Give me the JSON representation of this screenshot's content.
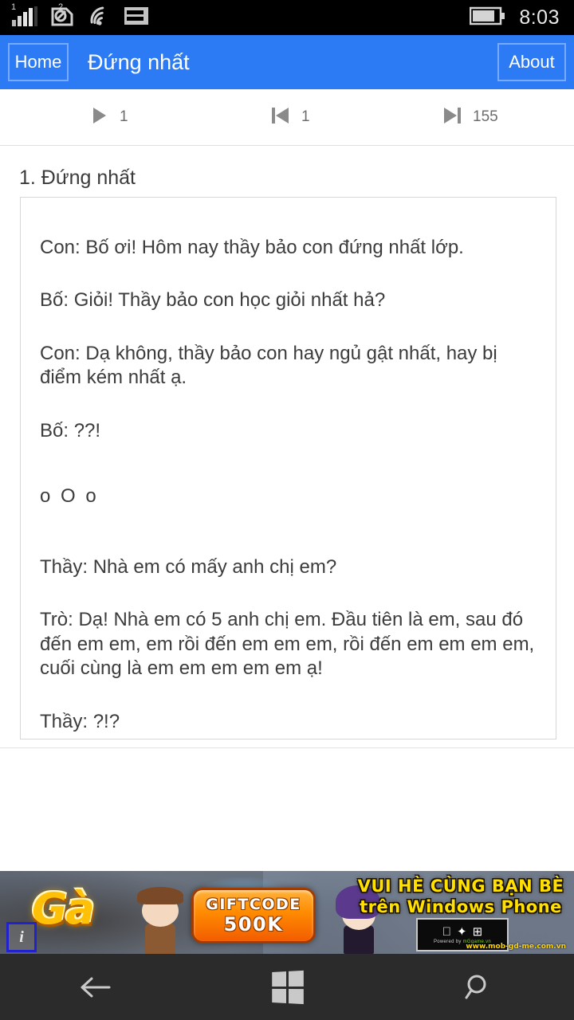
{
  "status_bar": {
    "signal_label": "1",
    "data_label": "2",
    "time": "8:03",
    "icons": [
      "signal-bars-icon",
      "data-connection-icon",
      "wifi-icon",
      "sim-card-icon",
      "battery-icon"
    ],
    "battery_level_pct": 75
  },
  "app_bar": {
    "home_label": "Home",
    "title": "Đứng nhất",
    "about_label": "About",
    "background_color": "#2d7bf4",
    "border_color": "#77aaf8"
  },
  "nav_controls": [
    {
      "icon": "play-icon",
      "value": "1"
    },
    {
      "icon": "skip-previous-icon",
      "value": "1"
    },
    {
      "icon": "skip-next-icon",
      "value": "155"
    }
  ],
  "content": {
    "title": "1. Đứng nhất",
    "paragraphs": [
      "Con: Bố ơi! Hôm nay thầy bảo con đứng nhất lớp.",
      "Bố: Giỏi! Thầy bảo con học giỏi nhất hả?",
      "Con: Dạ không, thầy bảo con hay ngủ gật nhất, hay bị điểm kém nhất ạ.",
      "Bố: ??!",
      "o O o",
      "Thầy: Nhà em có mấy anh chị em?",
      "Trò: Dạ! Nhà em có 5 anh chị em. Đầu tiên là em, sau đó đến em em, em rồi đến em em em, rồi đến em em em em, cuối cùng là em em em em em ạ!",
      "Thầy: ?!?"
    ]
  },
  "ad_banner": {
    "logo_text": "Gà",
    "giftcode_line1": "GIFTCODE",
    "giftcode_line2": "500K",
    "slogan_line1": "VUI HÈ CÙNG BẠN BÈ",
    "slogan_line2": "trên Windows Phone",
    "platform_icons": " ✦ ⊞",
    "publisher_text": "Powered by ",
    "publisher_highlight": "mGgame.vn",
    "info_badge": "i",
    "url_text": "www.mob-gd-me.com.vn"
  },
  "system_nav": {
    "back_label": "back-button",
    "start_label": "start-button",
    "search_label": "search-button"
  }
}
